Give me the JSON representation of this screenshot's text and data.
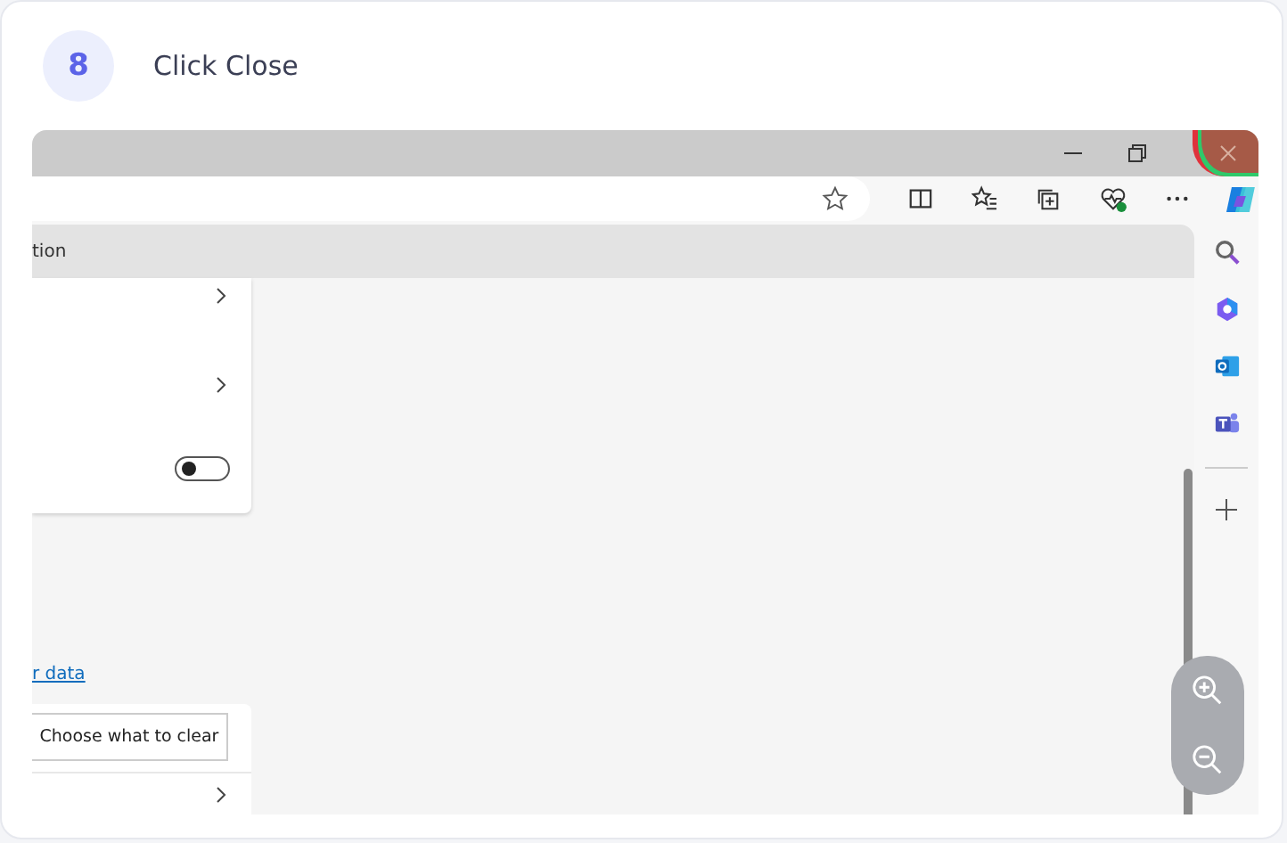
{
  "step": {
    "number": "8",
    "instruction": "Click Close"
  },
  "browser": {
    "close_highlighted": true,
    "settings_tab": "tion",
    "card_rows": [
      {
        "kind": "chevron"
      },
      {
        "kind": "chevron"
      },
      {
        "kind": "toggle",
        "on": false
      }
    ],
    "link": "r data",
    "clear_button": "Choose what to clear"
  }
}
